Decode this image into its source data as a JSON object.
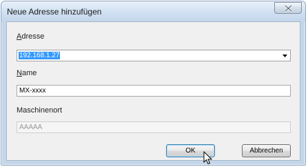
{
  "window": {
    "title": "Neue Adresse hinzufügen",
    "close_symbol": "X"
  },
  "address": {
    "label_first": "A",
    "label_rest": "dresse",
    "value": "192.168.1.27"
  },
  "name": {
    "label_first": "N",
    "label_rest": "ame",
    "value": "MX-xxxx"
  },
  "location": {
    "label": "Maschinenort",
    "value": "AAAAA"
  },
  "buttons": {
    "ok": "OK",
    "cancel": "Abbrechen"
  },
  "colors": {
    "selection": "#3399ff",
    "titlebar": "#d2e2f3",
    "client": "#f0f0f0"
  },
  "icons": {
    "close": "close-icon",
    "dropdown": "dropdown-arrow-icon",
    "cursor": "mouse-pointer-icon"
  }
}
